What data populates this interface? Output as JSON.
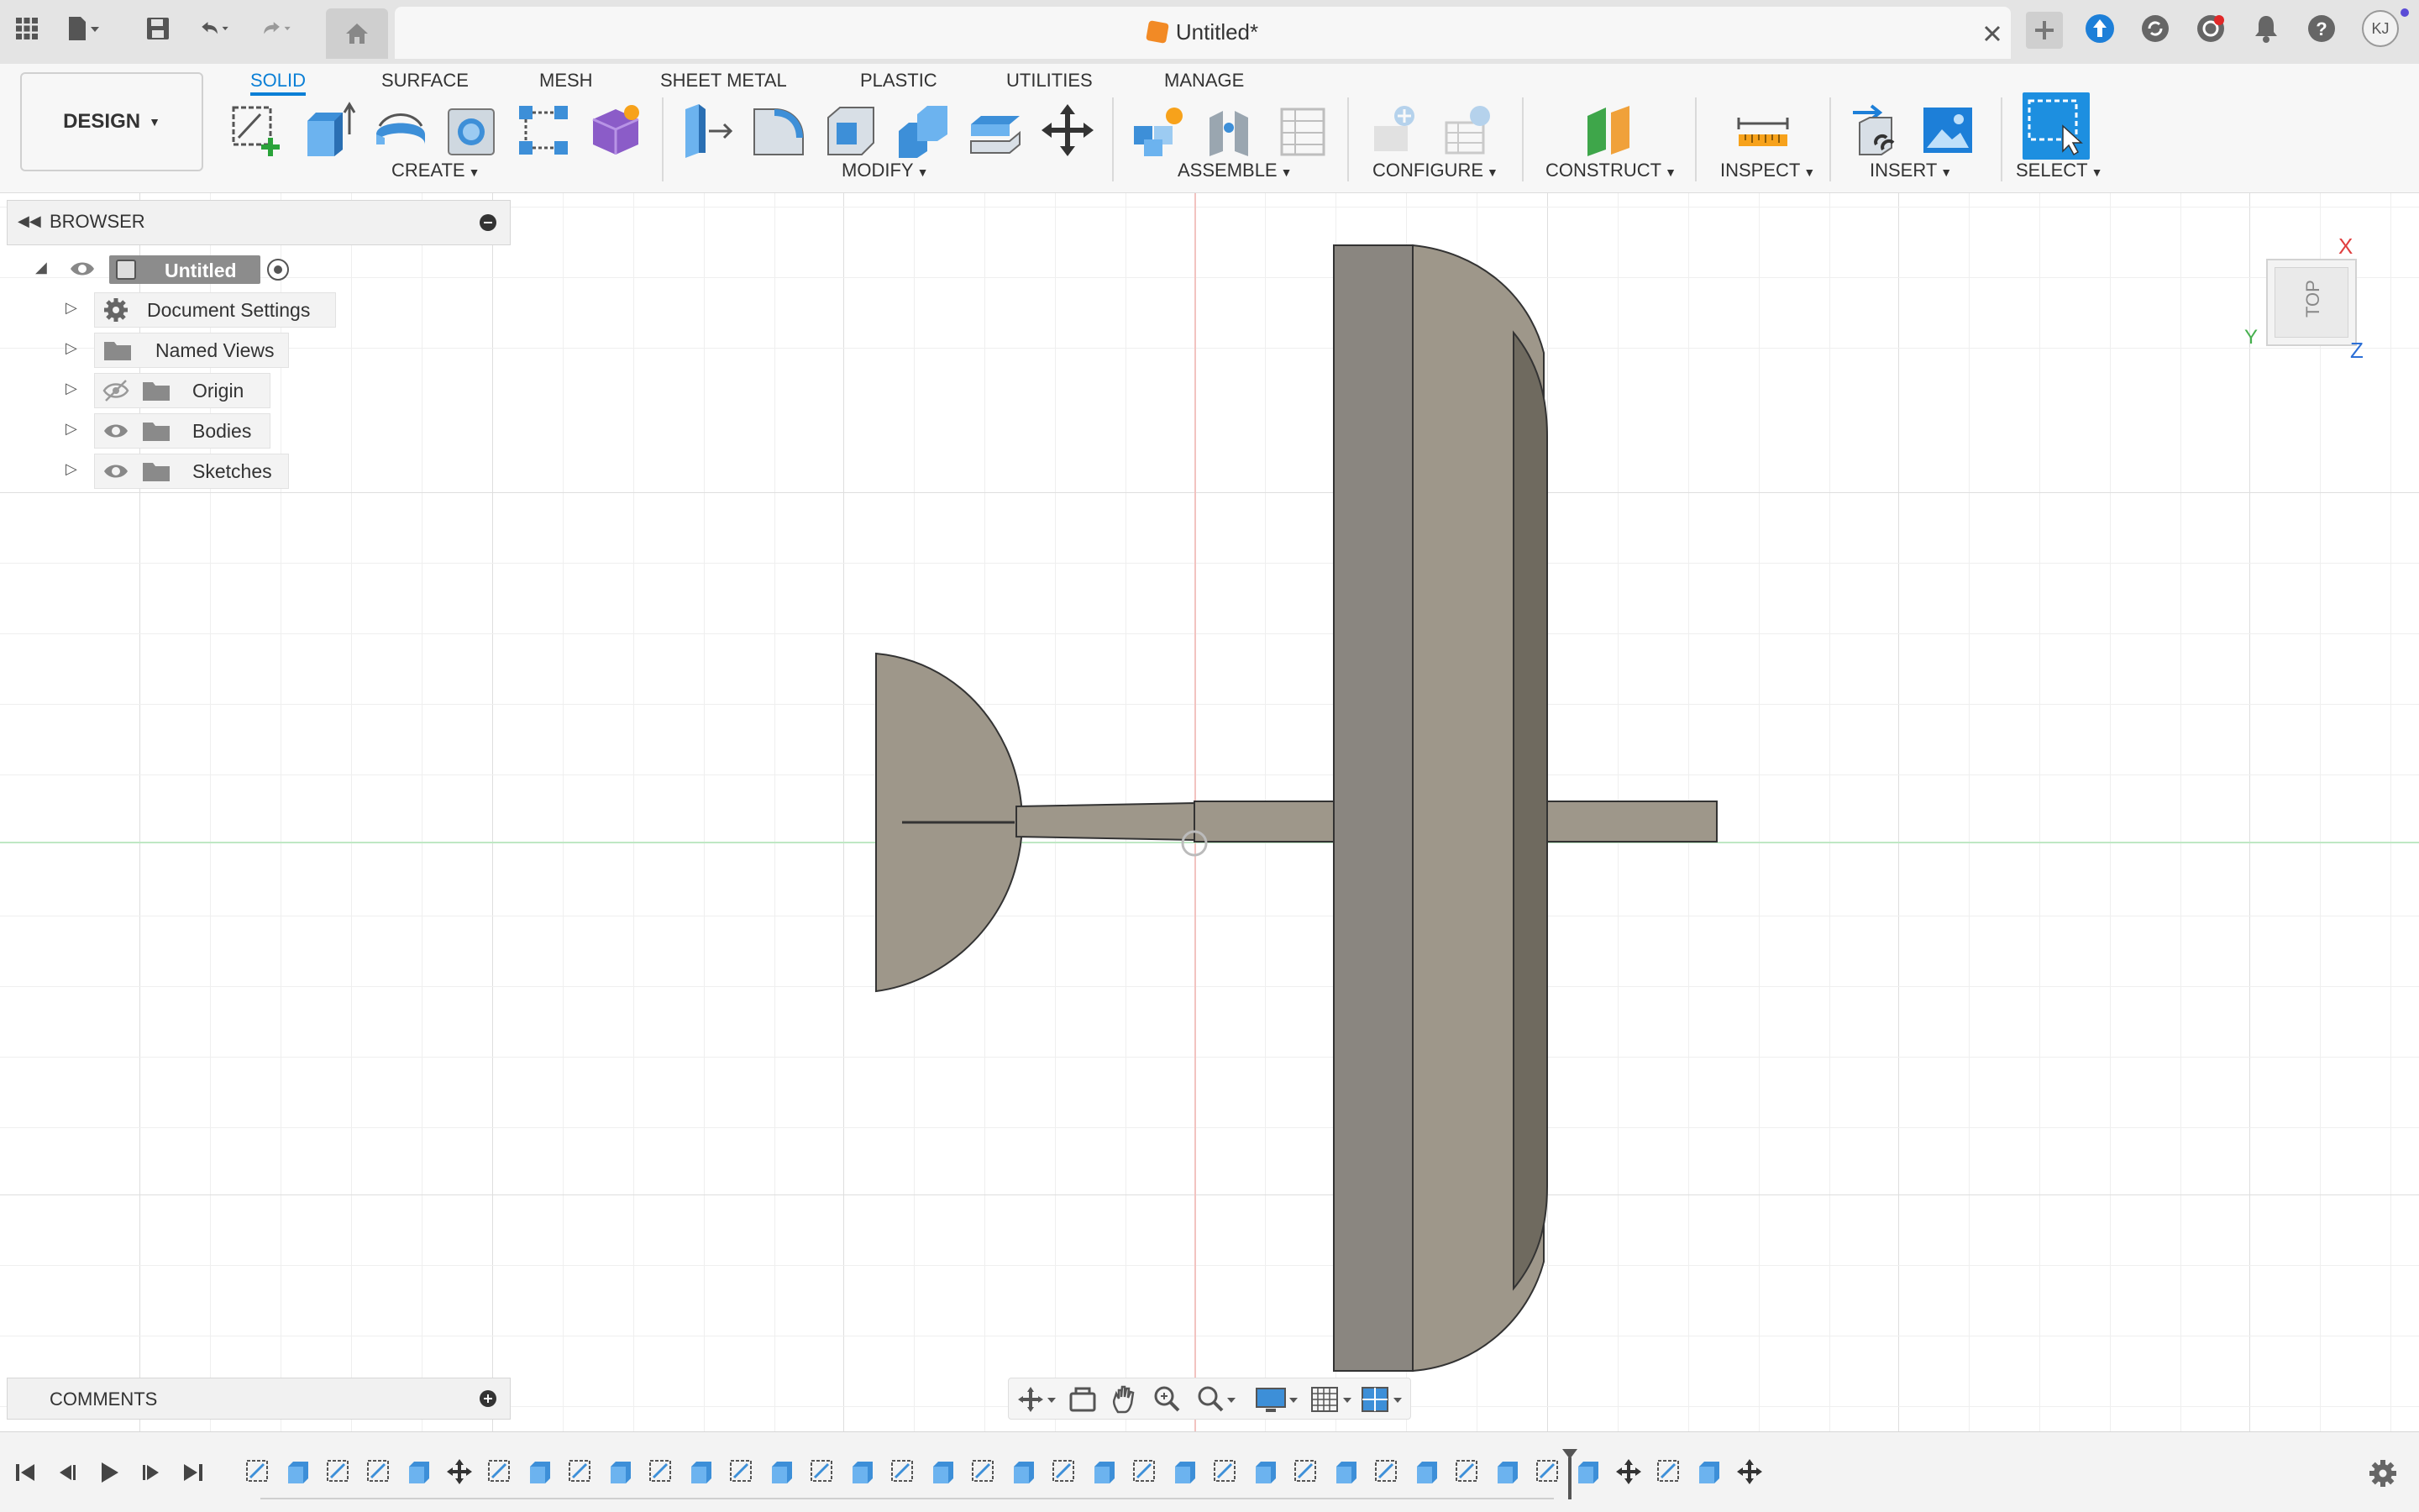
{
  "title_bar": {
    "document_title": "Untitled*",
    "icons": [
      "apps-grid-icon",
      "file-menu-icon",
      "save-icon",
      "undo-icon",
      "redo-icon",
      "home-icon",
      "close-tab-icon",
      "new-tab-icon",
      "extensions-icon",
      "job-status-icon",
      "notifications-icon",
      "help-icon",
      "user-avatar"
    ],
    "user_initials": "KJ"
  },
  "toolbar": {
    "workspace": "DESIGN",
    "tabs": [
      {
        "label": "SOLID",
        "active": true
      },
      {
        "label": "SURFACE",
        "active": false
      },
      {
        "label": "MESH",
        "active": false
      },
      {
        "label": "SHEET METAL",
        "active": false
      },
      {
        "label": "PLASTIC",
        "active": false
      },
      {
        "label": "UTILITIES",
        "active": false
      },
      {
        "label": "MANAGE",
        "active": false
      }
    ],
    "groups": {
      "create": "CREATE",
      "modify": "MODIFY",
      "assemble": "ASSEMBLE",
      "configure": "CONFIGURE",
      "construct": "CONSTRUCT",
      "inspect": "INSPECT",
      "insert": "INSERT",
      "select": "SELECT"
    },
    "accent": "#0a7fd6"
  },
  "browser": {
    "header": "BROWSER",
    "root": "Untitled",
    "items": [
      {
        "label": "Document Settings",
        "icon": "gear-icon"
      },
      {
        "label": "Named Views",
        "icon": "folder-icon"
      },
      {
        "label": "Origin",
        "icon": "folder-icon",
        "visibility": "hidden"
      },
      {
        "label": "Bodies",
        "icon": "folder-icon",
        "visibility": "visible"
      },
      {
        "label": "Sketches",
        "icon": "folder-icon",
        "visibility": "visible"
      }
    ]
  },
  "comments": {
    "header": "COMMENTS"
  },
  "viewcube": {
    "face": "TOP",
    "axes": {
      "x": "X",
      "y": "Y",
      "z": "Z"
    }
  },
  "model": {
    "body_color": "#9e978a",
    "body_dark": "#8a8680",
    "body_shadow": "#6f6a5f"
  }
}
